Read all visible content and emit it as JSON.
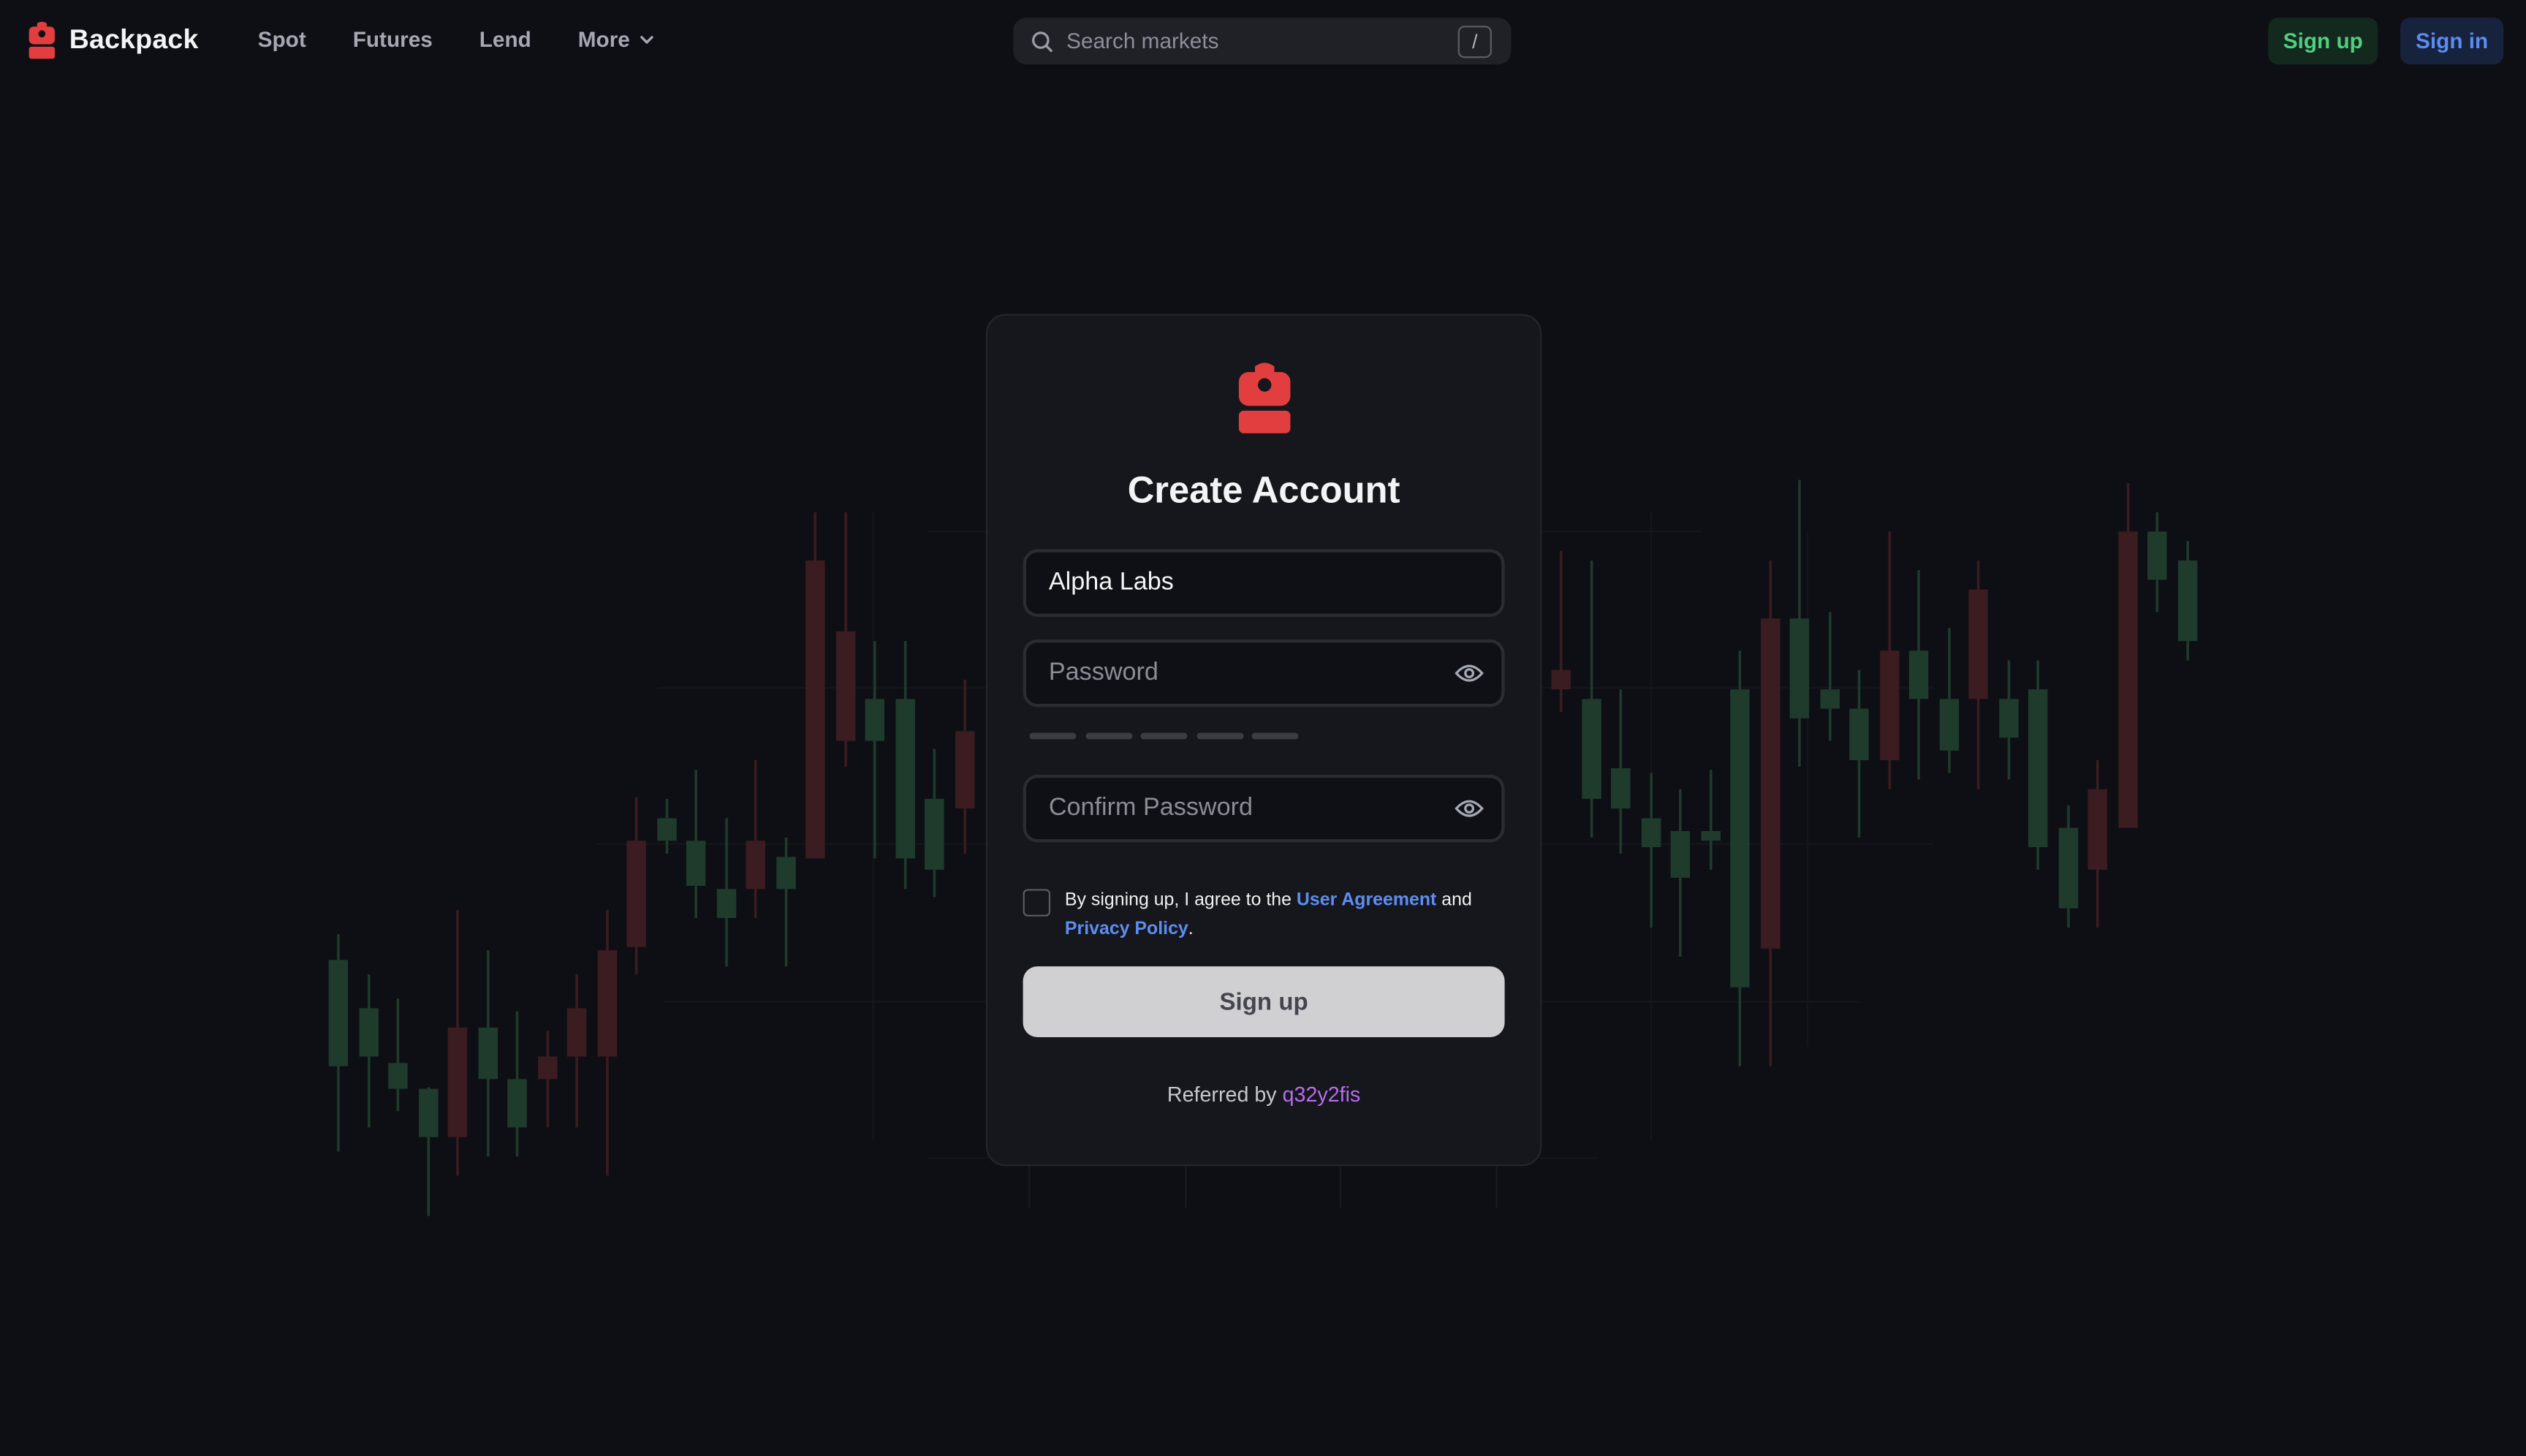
{
  "header": {
    "brand": "Backpack",
    "logo_icon": "backpack-logo-icon",
    "nav": [
      {
        "label": "Spot"
      },
      {
        "label": "Futures"
      },
      {
        "label": "Lend"
      },
      {
        "label": "More",
        "icon": "chevron-down-icon"
      }
    ],
    "search": {
      "placeholder": "Search markets",
      "value": "",
      "shortcut": "/",
      "icon": "search-icon"
    },
    "signup_label": "Sign up",
    "signin_label": "Sign in"
  },
  "form": {
    "title": "Create Account",
    "name_value": "Alpha Labs",
    "password_placeholder": "Password",
    "password_strength_segments": 5,
    "confirm_placeholder": "Confirm Password",
    "terms": {
      "checked": false,
      "prefix": "By signing up, I agree to the",
      "user_agreement": "User Agreement",
      "and": "and",
      "privacy_policy": "Privacy Policy",
      "suffix": "."
    },
    "submit_label": "Sign up",
    "referral_prefix": "Referred by",
    "referral_code": "q32y2fis"
  },
  "colors": {
    "background": "#0e0f14",
    "card": "#16171c",
    "brand_red": "#e33e3f",
    "up_green": "#1f3b2c",
    "down_red": "#3b1c20",
    "link_blue": "#5d8df3",
    "referral_purple": "#b76dee",
    "signup_green": "#4fcf7f"
  }
}
